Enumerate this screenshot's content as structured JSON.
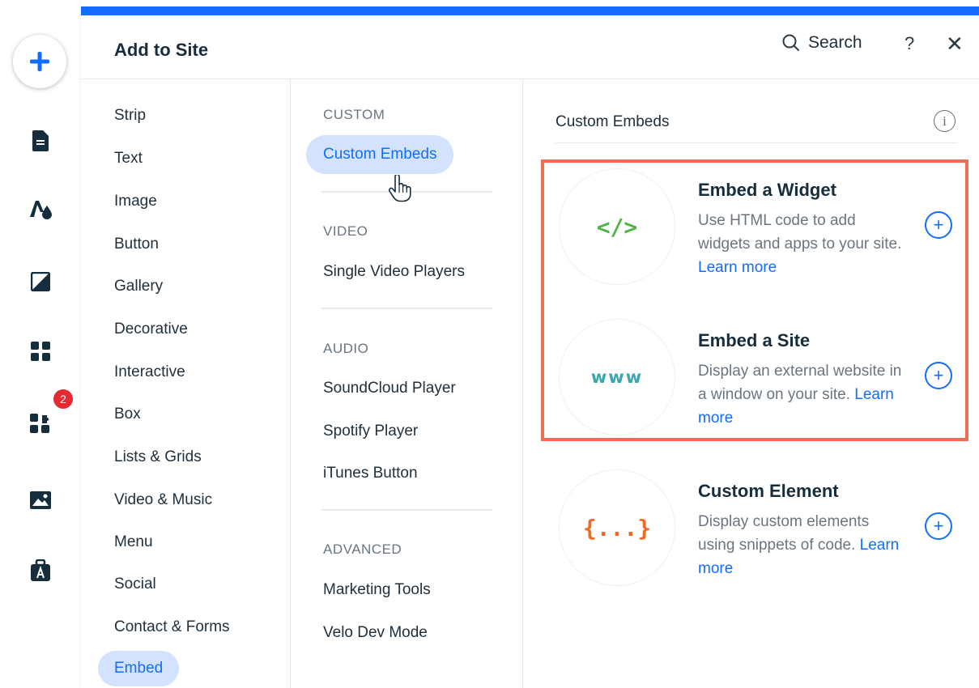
{
  "panel": {
    "title": "Add to Site",
    "search_label": "Search",
    "help_label": "?",
    "close_label": "✕"
  },
  "toolbar": {
    "items": [
      "add-icon",
      "pages-icon",
      "design-icon",
      "background-icon",
      "apps-grid-icon",
      "app-market-icon",
      "media-icon",
      "portfolio-icon"
    ],
    "app_market_badge": "2"
  },
  "categories": [
    "Strip",
    "Text",
    "Image",
    "Button",
    "Gallery",
    "Decorative",
    "Interactive",
    "Box",
    "Lists & Grids",
    "Video & Music",
    "Menu",
    "Social",
    "Contact & Forms",
    "Embed"
  ],
  "active_category": "Embed",
  "sections": [
    {
      "header": "CUSTOM",
      "items": [
        "Custom Embeds"
      ]
    },
    {
      "header": "VIDEO",
      "items": [
        "Single Video Players"
      ]
    },
    {
      "header": "AUDIO",
      "items": [
        "SoundCloud Player",
        "Spotify Player",
        "iTunes Button"
      ]
    },
    {
      "header": "ADVANCED",
      "items": [
        "Marketing Tools",
        "Velo Dev Mode"
      ]
    }
  ],
  "active_subcategory": "Custom Embeds",
  "content": {
    "header": "Custom Embeds",
    "items": [
      {
        "title": "Embed a Widget",
        "description": "Use HTML code to add widgets and apps to your site.",
        "link": "Learn more",
        "glyph": "</>"
      },
      {
        "title": "Embed a Site",
        "description": "Display an external website in a window on your site.",
        "link": "Learn more",
        "glyph": "www"
      },
      {
        "title": "Custom Element",
        "description": "Display custom elements using snippets of code.",
        "link": "Learn more",
        "glyph": "{...}"
      }
    ]
  },
  "colors": {
    "accent": "#116dff",
    "highlight": "#f06d55",
    "badge": "#e62a32"
  }
}
